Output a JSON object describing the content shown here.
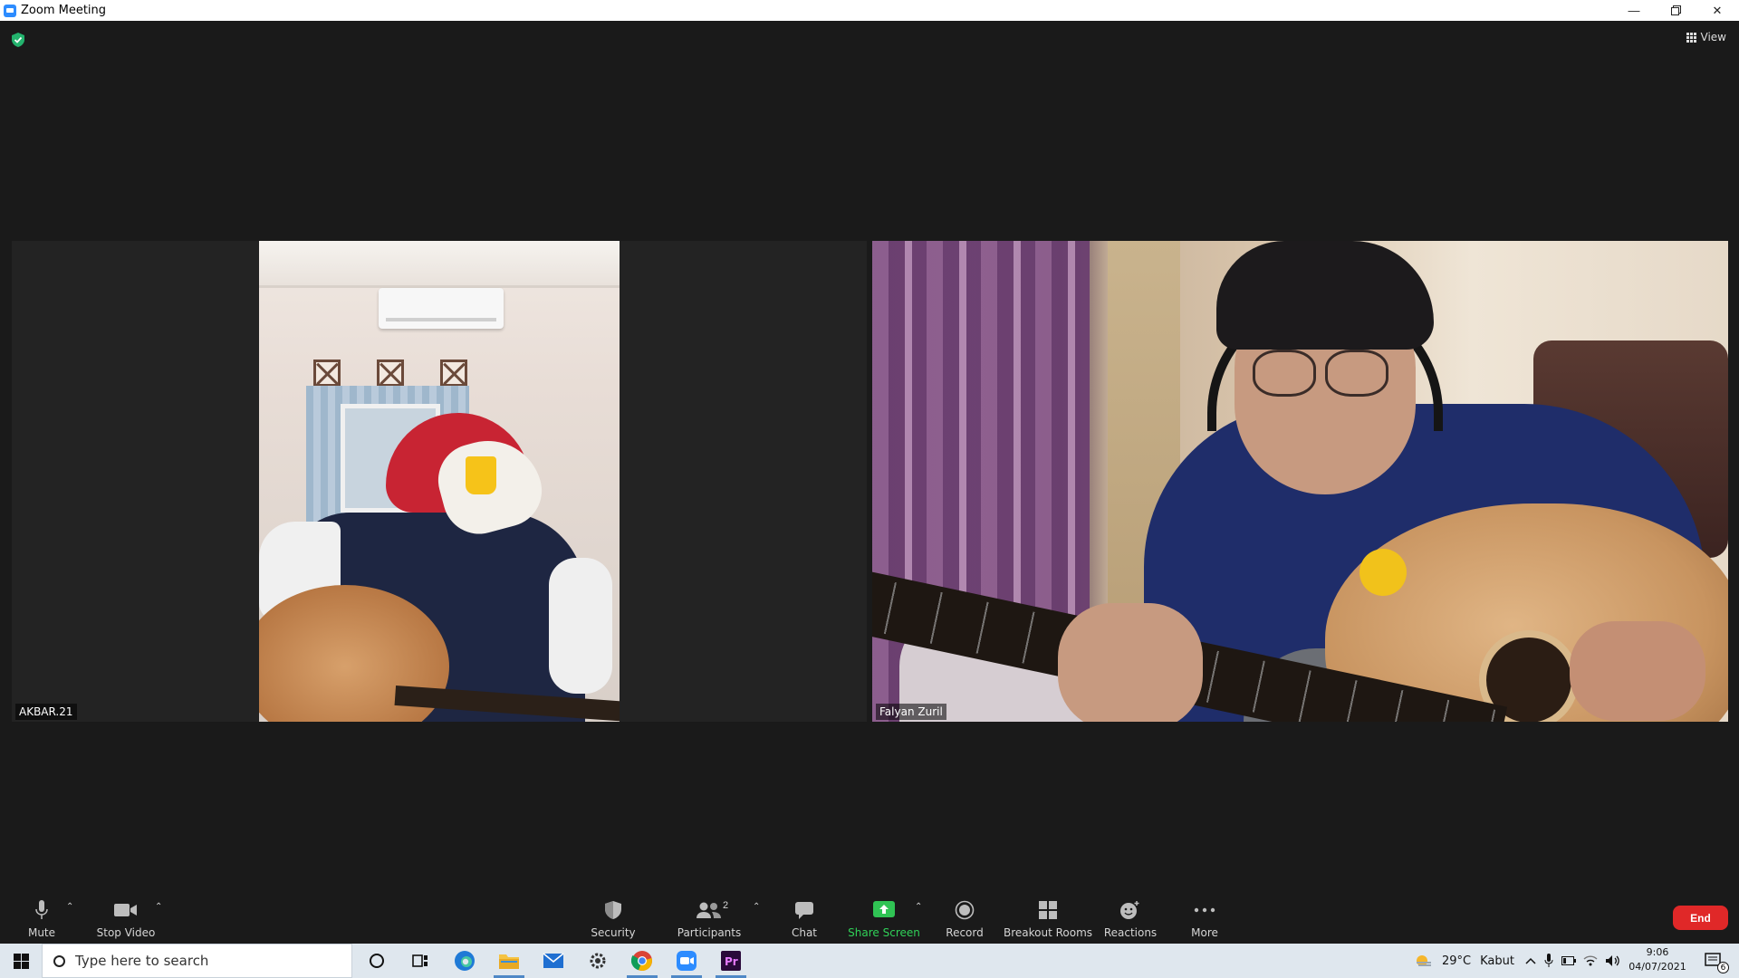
{
  "window": {
    "title": "Zoom Meeting"
  },
  "meeting": {
    "view_label": "View",
    "participants": [
      {
        "name": "AKBAR.21"
      },
      {
        "name": "Falyan Zuril"
      }
    ]
  },
  "toolbar": {
    "mute": "Mute",
    "stop_video": "Stop Video",
    "security": "Security",
    "participants": "Participants",
    "participants_count": "2",
    "chat": "Chat",
    "share_screen": "Share Screen",
    "record": "Record",
    "breakout_rooms": "Breakout Rooms",
    "reactions": "Reactions",
    "more": "More",
    "end": "End"
  },
  "taskbar": {
    "search_placeholder": "Type here to search",
    "weather_temp": "29°C",
    "weather_desc": "Kabut",
    "time": "9:06",
    "date": "04/07/2021",
    "notifications": "6"
  },
  "colors": {
    "accent_green": "#30d158",
    "end_red": "#e02828",
    "meeting_bg": "#1a1a1a"
  }
}
